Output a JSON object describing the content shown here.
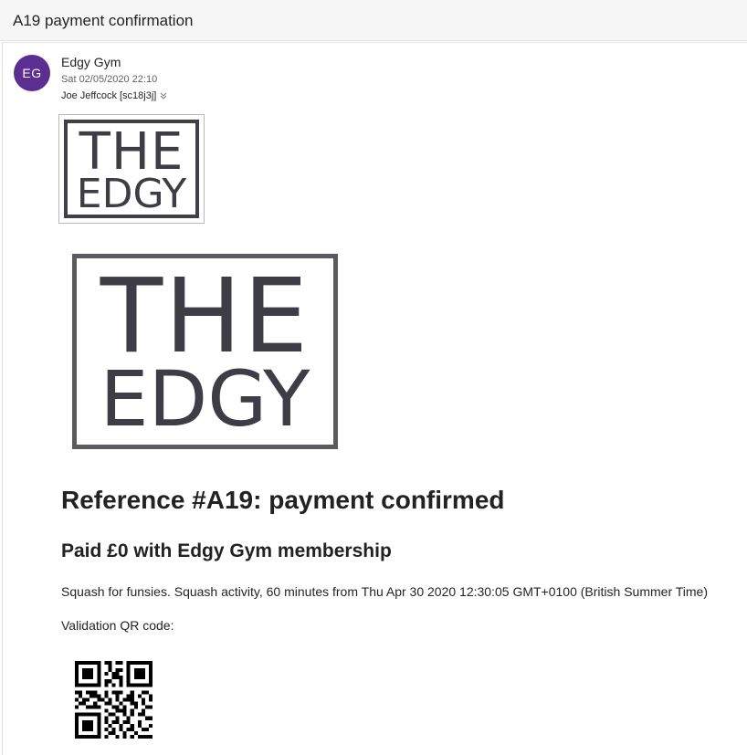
{
  "subject": "A19 payment confirmation",
  "message": {
    "avatar_initials": "EG",
    "avatar_color": "#5c2e91",
    "sender": "Edgy Gym",
    "date": "Sat 02/05/2020 22:10",
    "recipient": "Joe Jeffcock [sc18j3j]"
  },
  "logo": {
    "line1": "THE",
    "line2": "EDGY"
  },
  "content": {
    "heading": "Reference #A19: payment confirmed",
    "subheading": "Paid £0 with Edgy Gym membership",
    "description": "Squash for funsies. Squash activity, 60 minutes from Thu Apr 30 2020 12:30:05 GMT+0100 (British Summer Time)",
    "qr_label": "Validation QR code:"
  },
  "icons": {
    "recipient_expand": "chevron-double-down-icon",
    "qr": "qr-code-icon"
  }
}
